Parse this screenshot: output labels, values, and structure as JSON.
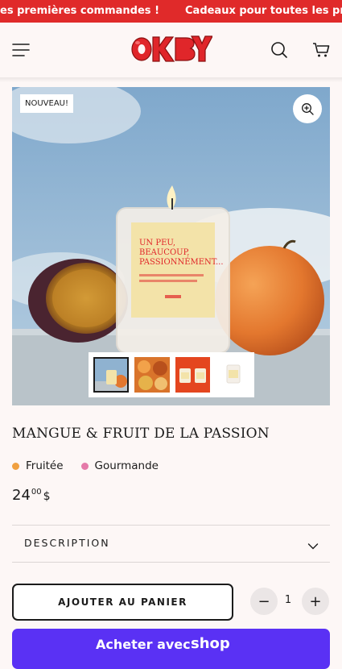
{
  "announcement": {
    "left_text": "es premières commandes !",
    "right_text": "Cadeaux pour toutes les prem"
  },
  "header": {
    "logo_text": "OK BYE",
    "menu_icon": "hamburger-menu-icon",
    "search_icon": "search-icon",
    "cart_icon": "cart-icon"
  },
  "product": {
    "badge": "NOUVEAU!",
    "candle_label": "UN PEU, BEAUCOUP, PASSIONNÉMENT...",
    "title": "MANGUE & FRUIT DE LA PASSION",
    "notes": [
      {
        "label": "Fruitée",
        "color": "#f0a040"
      },
      {
        "label": "Gourmande",
        "color": "#e57aa9"
      }
    ],
    "price": {
      "whole": "24",
      "cents": "00",
      "currency": "$"
    },
    "thumbnails": [
      "thumb-candle-scene",
      "thumb-fruits",
      "thumb-orange-candles",
      "thumb-white-candle"
    ]
  },
  "description": {
    "label": "DESCRIPTION"
  },
  "purchase": {
    "add_to_cart": "AJOUTER AU PANIER",
    "quantity": "1",
    "minus": "−",
    "plus": "+",
    "shop_pay_prefix": "Acheter avec",
    "shop_pay_brand": "shop"
  },
  "colors": {
    "announcement_bg": "#e02a2a",
    "brand_red": "#e0262a",
    "shop_pay": "#5a31f4"
  }
}
